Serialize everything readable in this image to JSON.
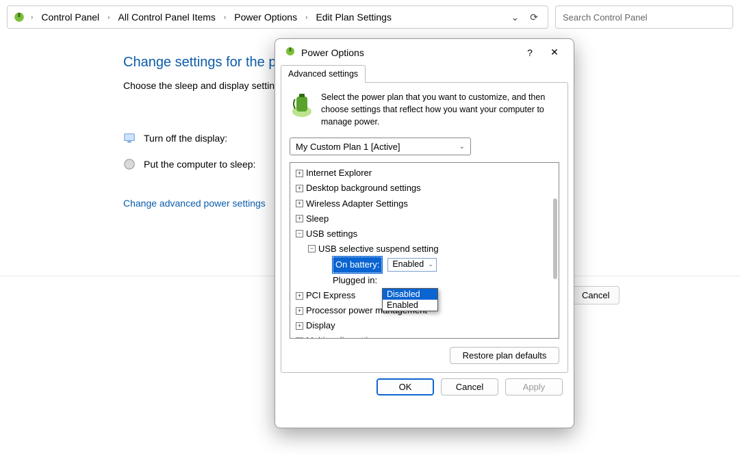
{
  "breadcrumb": {
    "items": [
      "Control Panel",
      "All Control Panel Items",
      "Power Options",
      "Edit Plan Settings"
    ]
  },
  "search": {
    "placeholder": "Search Control Panel"
  },
  "page": {
    "title": "Change settings for the plan",
    "subtitle": "Choose the sleep and display settings",
    "opt_display": "Turn off the display:",
    "opt_sleep": "Put the computer to sleep:",
    "link_advanced": "Change advanced power settings"
  },
  "float_button": "Cancel",
  "dialog": {
    "title": "Power Options",
    "help": "?",
    "tab": "Advanced settings",
    "intro": "Select the power plan that you want to customize, and then choose settings that reflect how you want your computer to manage power.",
    "selected_plan": "My Custom Plan 1 [Active]",
    "tree": {
      "internet_explorer": "Internet Explorer",
      "desktop_bg": "Desktop background settings",
      "wireless": "Wireless Adapter Settings",
      "sleep": "Sleep",
      "usb": "USB settings",
      "usb_selective": "USB selective suspend setting",
      "on_battery_label": "On battery:",
      "on_battery_value": "Enabled",
      "plugged_in_label": "Plugged in:",
      "pci": "PCI Express",
      "proc": "Processor power management",
      "display": "Display",
      "multimedia": "Multimedia settings"
    },
    "dropdown": {
      "opt_disabled": "Disabled",
      "opt_enabled": "Enabled"
    },
    "restore": "Restore plan defaults",
    "ok": "OK",
    "cancel": "Cancel",
    "apply": "Apply"
  }
}
